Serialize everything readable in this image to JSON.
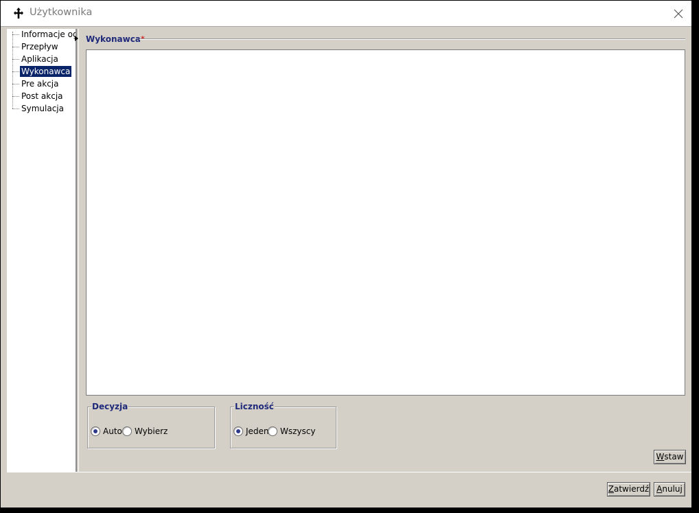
{
  "window": {
    "title": "Użytkownika",
    "app_icon": "move-cross-icon",
    "close_icon": "close-icon"
  },
  "tree": {
    "items": [
      {
        "label": "Informacje ogólne"
      },
      {
        "label": "Przepływ"
      },
      {
        "label": "Aplikacja"
      },
      {
        "label": "Wykonawca",
        "selected": true
      },
      {
        "label": "Pre akcja"
      },
      {
        "label": "Post akcja"
      },
      {
        "label": "Symulacja"
      }
    ]
  },
  "main": {
    "group_title": "Wykonawca",
    "required_mark": "*",
    "decyzja": {
      "legend": "Decyzja",
      "options": [
        {
          "label": "Auto",
          "checked": true
        },
        {
          "label": "Wybierz",
          "checked": false
        }
      ]
    },
    "licznosc": {
      "legend": "Liczność",
      "options": [
        {
          "label": "Jeden",
          "checked": true
        },
        {
          "label": "Wszyscy",
          "checked": false
        }
      ]
    },
    "insert_button": {
      "mnemonic": "W",
      "rest": "staw"
    }
  },
  "footer": {
    "confirm_button": {
      "mnemonic": "Z",
      "rest": "atwierdź"
    },
    "cancel_button": {
      "mnemonic": "A",
      "rest": "nuluj"
    }
  }
}
